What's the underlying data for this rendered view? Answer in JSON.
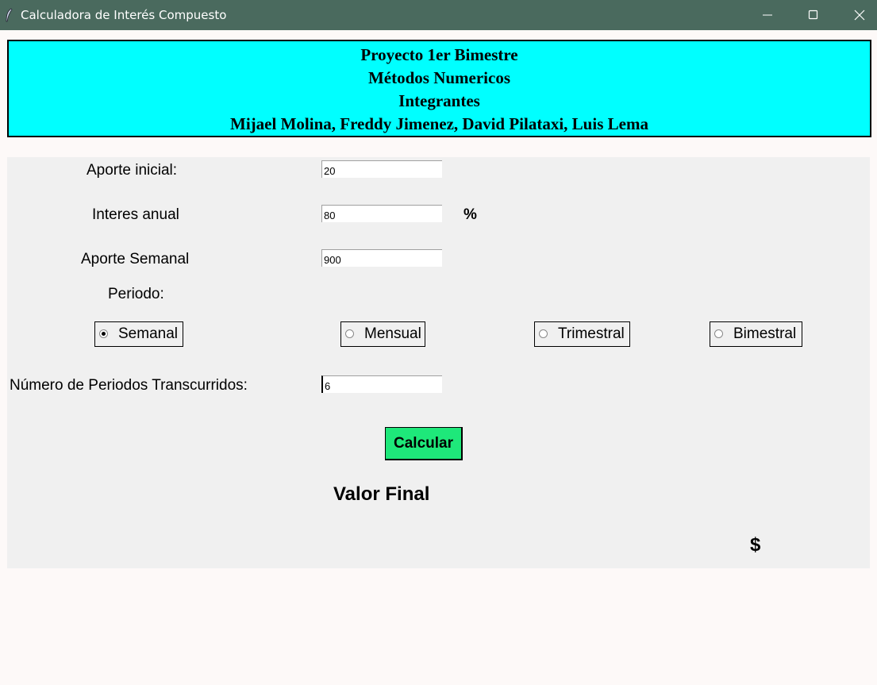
{
  "window": {
    "title": "Calculadora de Interés Compuesto",
    "icon": "feather-icon"
  },
  "header": {
    "line1": "Proyecto 1er Bimestre",
    "line2": "Métodos Numericos",
    "line3": "Integrantes",
    "line4": "Mijael Molina, Freddy Jimenez, David Pilataxi, Luis Lema"
  },
  "form": {
    "aporte_inicial_label": "Aporte inicial:",
    "aporte_inicial_value": "20",
    "interes_label": "Interes anual",
    "interes_value": "80",
    "percent_symbol": "%",
    "aporte_semanal_label": "Aporte Semanal",
    "aporte_semanal_value": "900",
    "periodo_label": "Periodo:",
    "periodos": [
      {
        "label": "Semanal",
        "selected": true
      },
      {
        "label": "Mensual",
        "selected": false
      },
      {
        "label": "Trimestral",
        "selected": false
      },
      {
        "label": "Bimestral",
        "selected": false
      }
    ],
    "num_periodos_label": "Número de Periodos Transcurridos:",
    "num_periodos_value": "6",
    "calcular_label": "Calcular",
    "valor_final_label": "Valor Final",
    "currency_symbol": "$"
  },
  "colors": {
    "titlebar": "#4a6a5e",
    "header_bg": "#00ffff",
    "button_bg": "#1ee87a"
  }
}
